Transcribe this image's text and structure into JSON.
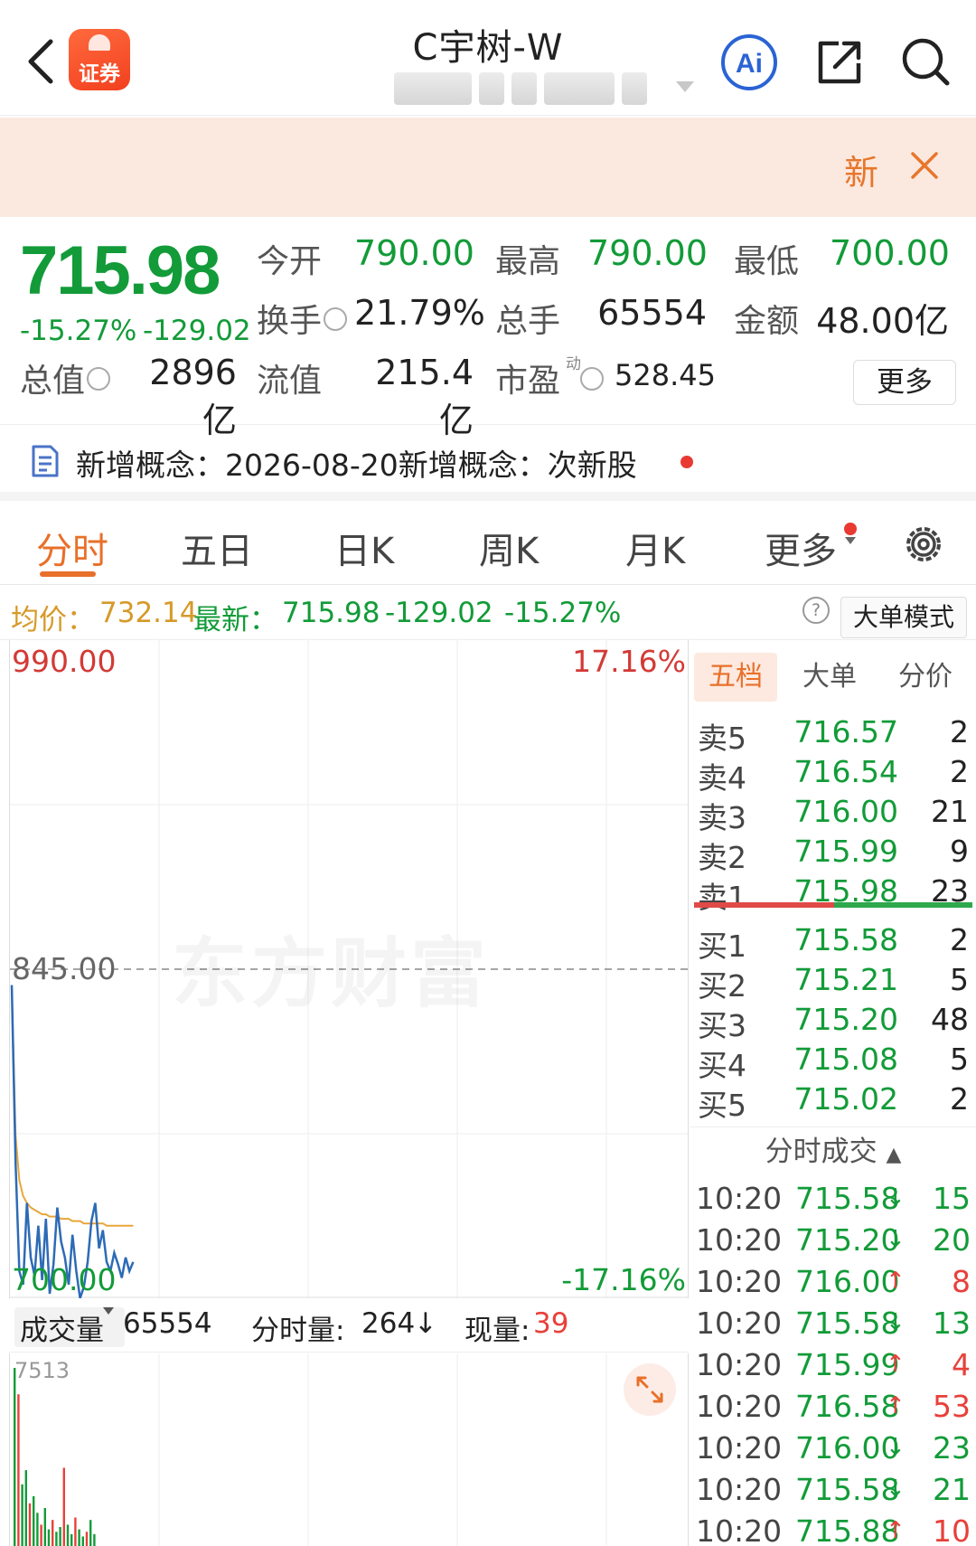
{
  "header": {
    "title": "C宇树-W",
    "logo_text": "证券"
  },
  "banner": {
    "text": "新"
  },
  "quote": {
    "price": "715.98",
    "change_pct": "-15.27%",
    "change_abs": "-129.02",
    "open_label": "今开",
    "open_value": "790.00",
    "high_label": "最高",
    "high_value": "790.00",
    "low_label": "最低",
    "low_value": "700.00",
    "turnover_label": "换手",
    "turnover_value": "21.79%",
    "volume_label": "总手",
    "volume_value": "65554",
    "amount_label": "金额",
    "amount_value": "48.00亿",
    "mcap_label": "总值",
    "mcap_value": "2896亿",
    "float_label": "流值",
    "float_value": "215.4亿",
    "pe_label": "市盈",
    "pe_sup": "动",
    "pe_value": "528.45",
    "more_label": "更多"
  },
  "concept": {
    "text": "新增概念：2026-08-20新增概念：次新股"
  },
  "tabs": [
    "分时",
    "五日",
    "日K",
    "周K",
    "月K",
    "更多"
  ],
  "avg_bar": {
    "avg_label": "均价：",
    "avg_value": "732.14",
    "latest_label": "最新：",
    "latest_value": "715.98",
    "change_abs": "-129.02",
    "change_pct": "-15.27%",
    "help": "?",
    "big_order_button": "大单模式"
  },
  "chart": {
    "y_top": "990.00",
    "y_mid": "845.00",
    "y_bottom": "700.00",
    "pct_top": "17.16%",
    "pct_bottom": "-17.16%",
    "watermark": "东方财富"
  },
  "volume_bar": {
    "selector": "成交量",
    "total": "65554",
    "minute_vol_label": "分时量:",
    "minute_vol_value": "264",
    "current_label": "现量:",
    "current_value": "39",
    "max_label": "7513"
  },
  "order_book": {
    "tabs": [
      "五档",
      "大单",
      "分价"
    ],
    "asks": [
      {
        "label": "卖5",
        "price": "716.57",
        "vol": "2"
      },
      {
        "label": "卖4",
        "price": "716.54",
        "vol": "2"
      },
      {
        "label": "卖3",
        "price": "716.00",
        "vol": "21"
      },
      {
        "label": "卖2",
        "price": "715.99",
        "vol": "9"
      },
      {
        "label": "卖1",
        "price": "715.98",
        "vol": "23"
      }
    ],
    "bids": [
      {
        "label": "买1",
        "price": "715.58",
        "vol": "2"
      },
      {
        "label": "买2",
        "price": "715.21",
        "vol": "5"
      },
      {
        "label": "买3",
        "price": "715.20",
        "vol": "48"
      },
      {
        "label": "买4",
        "price": "715.08",
        "vol": "5"
      },
      {
        "label": "买5",
        "price": "715.02",
        "vol": "2"
      }
    ],
    "trades_title": "分时成交",
    "trades": [
      {
        "time": "10:20",
        "price": "715.58",
        "dir": "↓",
        "vol": "15"
      },
      {
        "time": "10:20",
        "price": "715.20",
        "dir": "↓",
        "vol": "20"
      },
      {
        "time": "10:20",
        "price": "716.00",
        "dir": "↑",
        "vol": "8"
      },
      {
        "time": "10:20",
        "price": "715.58",
        "dir": "↓",
        "vol": "13"
      },
      {
        "time": "10:20",
        "price": "715.99",
        "dir": "↑",
        "vol": "4"
      },
      {
        "time": "10:20",
        "price": "716.58",
        "dir": "↑",
        "vol": "53"
      },
      {
        "time": "10:20",
        "price": "716.00",
        "dir": "↓",
        "vol": "23"
      },
      {
        "time": "10:20",
        "price": "715.58",
        "dir": "↓",
        "vol": "21"
      },
      {
        "time": "10:20",
        "price": "715.88",
        "dir": "↑",
        "vol": "10"
      }
    ]
  },
  "colors": {
    "up": "#e8403a",
    "down": "#129b38",
    "accent": "#e8702a",
    "avg_line": "#e8a63a",
    "price_line": "#2d6bb6"
  },
  "icons": [
    "back-icon",
    "logo-icon",
    "ai-icon",
    "share-icon",
    "search-icon",
    "close-icon",
    "doc-icon",
    "settings-icon",
    "help-icon",
    "expand-icon"
  ],
  "intraday": {
    "price": [
      838,
      760,
      712,
      706,
      742,
      718,
      710,
      732,
      708,
      735,
      702,
      715,
      740,
      725,
      718,
      706,
      728,
      712,
      700,
      705,
      716,
      734,
      742,
      722,
      730,
      716,
      712,
      720,
      715,
      709,
      718,
      712,
      716
    ],
    "avg": [
      838,
      772,
      752,
      745,
      742,
      740,
      739,
      738,
      737,
      737,
      736,
      736,
      736,
      735,
      735,
      735,
      734,
      734,
      734,
      733,
      733,
      733,
      733,
      733,
      733,
      732,
      732,
      732,
      732,
      732,
      732,
      732,
      732
    ],
    "volume": [
      7513,
      6400,
      2600,
      3200,
      1800,
      2100,
      1400,
      900,
      1600,
      700,
      1100,
      600,
      800,
      3300,
      900,
      500,
      1200,
      700,
      400,
      600,
      1100,
      500
    ]
  }
}
